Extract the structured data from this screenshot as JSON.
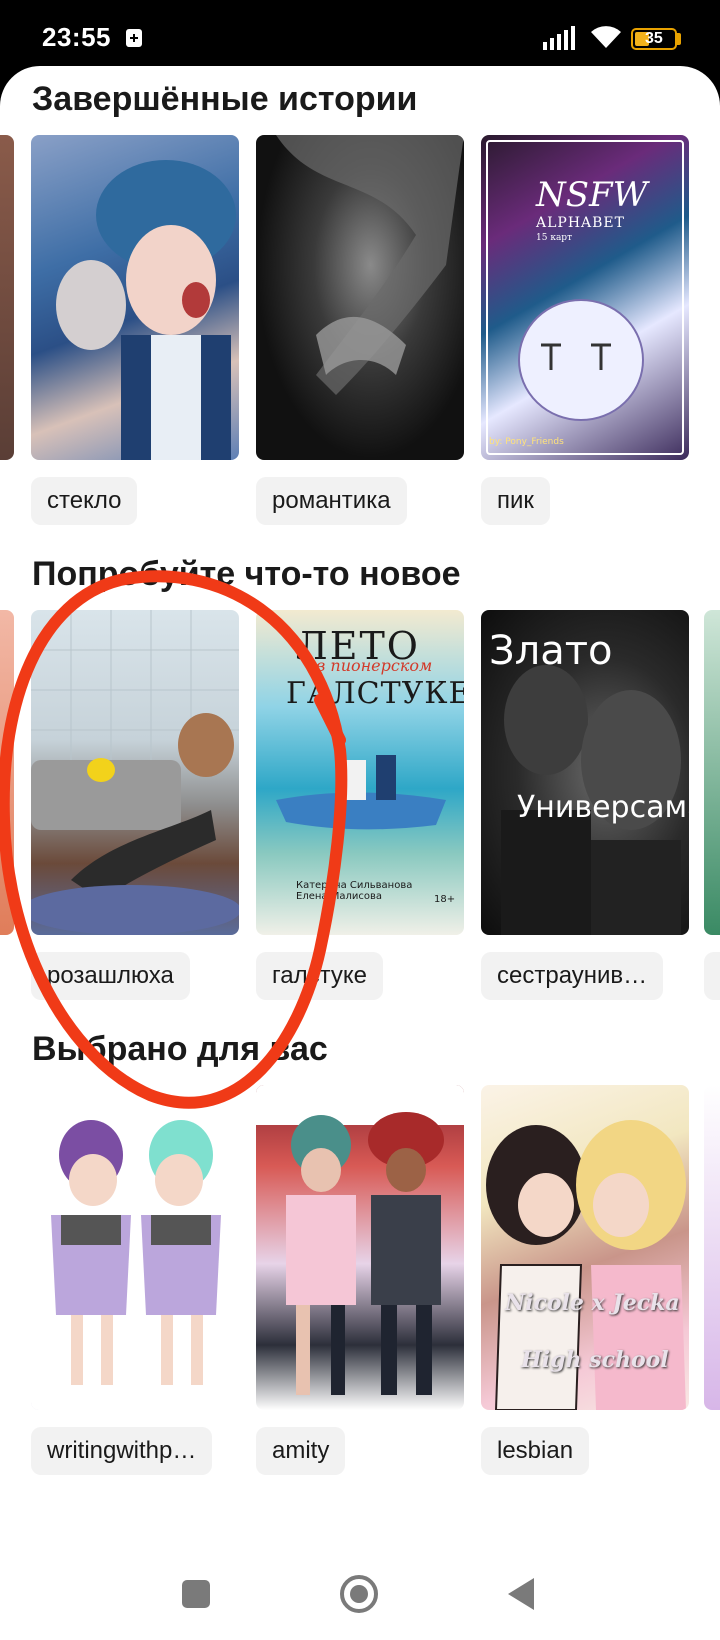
{
  "status": {
    "time": "23:55",
    "battery": "35"
  },
  "sections": [
    {
      "title": "Завершённые истории",
      "items": [
        {
          "tag": "стекло",
          "cover": "anime-character-crying-cover"
        },
        {
          "tag": "романтика",
          "cover": "dark-monochrome-cover"
        },
        {
          "tag": "пик",
          "cover": "nsfw-alphabet-cover",
          "cover_title": "NSFW",
          "cover_subtitle": "ALPHABET",
          "cover_note": "15 карт",
          "cover_author": "by: Pony_Friends"
        }
      ]
    },
    {
      "title": "Попробуйте что-то новое",
      "items": [
        {
          "tag": "розашлюха",
          "cover": "bathroom-cartoon-cover"
        },
        {
          "tag": "галстуке",
          "cover": "leto-v-galstuke-cover",
          "cover_title": "ЛЕТО",
          "cover_title2": "ГАЛСТУКЕ",
          "cover_script": "в пионерском",
          "cover_authors": "Катерина Сильванова\nЕлена Малисова",
          "cover_age": "18+"
        },
        {
          "tag": "сестраунив…",
          "cover": "zlato-universama-cover",
          "cover_title": "Злато",
          "cover_title2": "Универсама"
        }
      ]
    },
    {
      "title": "Выбрано для вас",
      "items": [
        {
          "tag": "writingwithp…",
          "cover": "two-girls-illustration-cover"
        },
        {
          "tag": "amity",
          "cover": "amity-illustration-cover"
        },
        {
          "tag": "lesbian",
          "cover": "nicole-jecka-cover",
          "cover_title": "Nicole x Jecka",
          "cover_title2": "High school"
        }
      ]
    }
  ],
  "colors": {
    "annotation": "#f03a17",
    "chip_bg": "#f2f2f2",
    "nav_icon": "#7a7a7a"
  },
  "icons": [
    "signal-icon",
    "wifi-icon",
    "battery-icon",
    "recent-apps-icon",
    "home-icon",
    "back-icon"
  ]
}
